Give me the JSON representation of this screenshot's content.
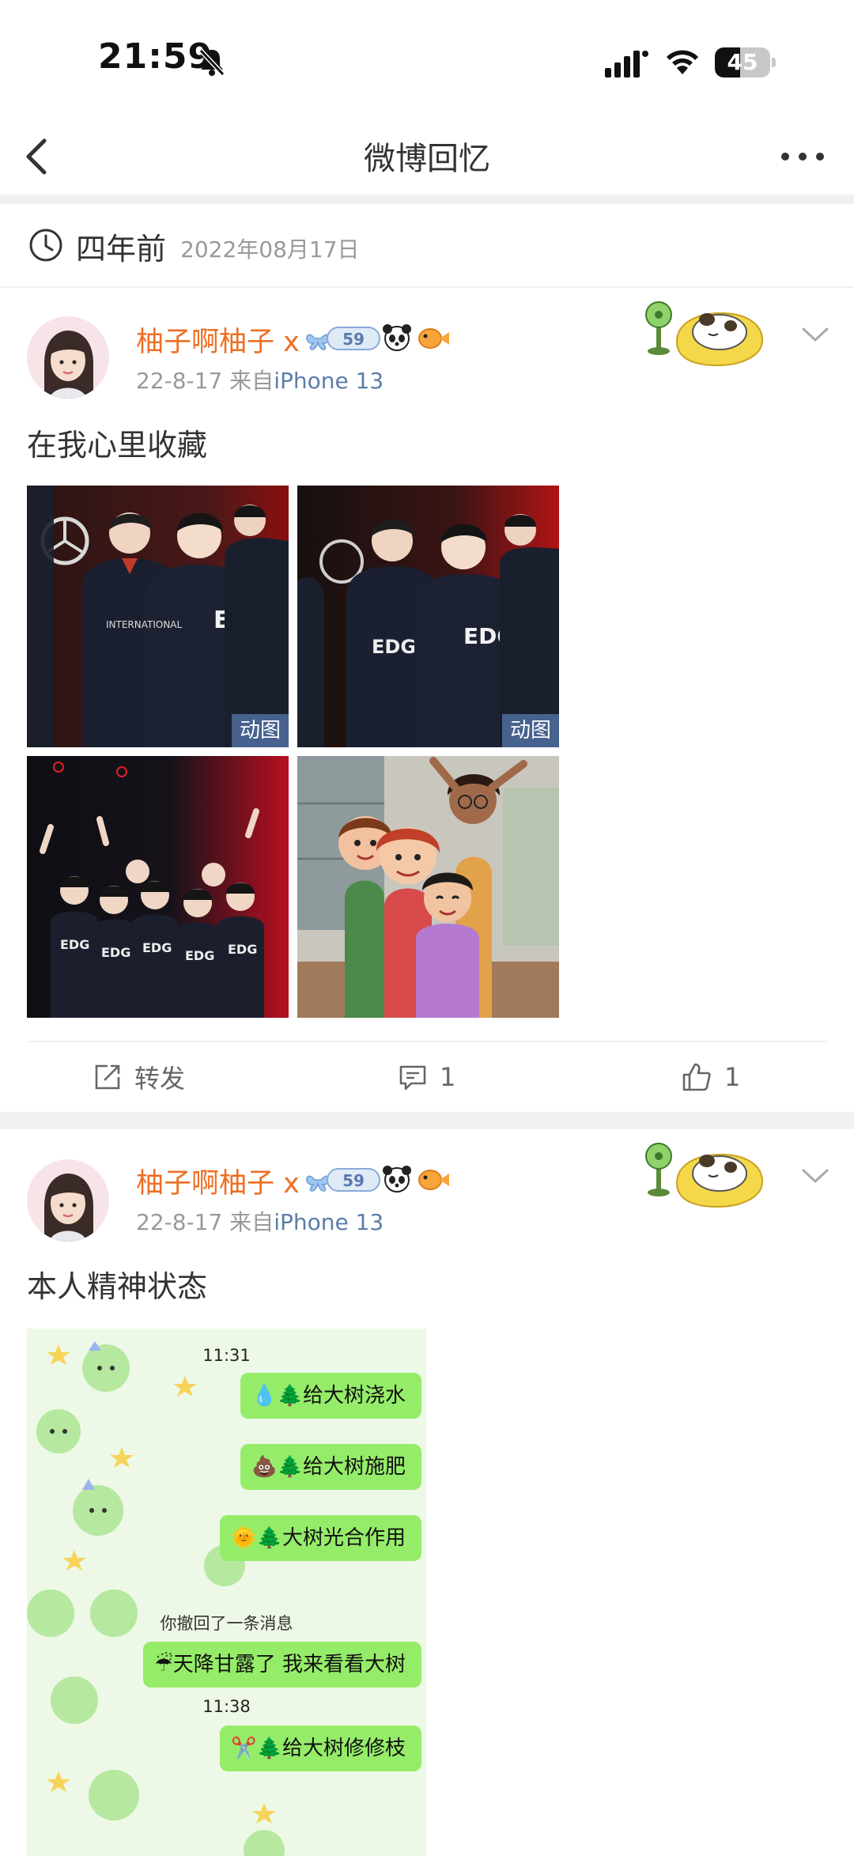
{
  "status_bar": {
    "time": "21:59",
    "battery_level": "45",
    "battery_fraction": 0.45
  },
  "nav": {
    "title": "微博回忆",
    "back_icon": "chevron-left-icon",
    "more_icon": "more-dots-icon"
  },
  "memory_header": {
    "icon": "clock-icon",
    "label": "四年前",
    "date": "2022年08月17日"
  },
  "colors": {
    "username": "#ee6f24",
    "device_link": "#5c7da8",
    "chat_bubble": "#95ec69",
    "separator": "#f1f1f1"
  },
  "posts": [
    {
      "username": "柚子啊柚子",
      "username_suffix": "x",
      "level": "59",
      "meta_prefix": "22-8-17  来自",
      "device": "iPhone 13",
      "text": "在我心里收藏",
      "images": [
        {
          "tag": "动图"
        },
        {
          "tag": "动图"
        },
        {
          "tag": ""
        },
        {
          "tag": ""
        }
      ],
      "actions": {
        "repost_label": "转发",
        "comment_count": "1",
        "like_count": "1"
      }
    },
    {
      "username": "柚子啊柚子",
      "username_suffix": "x",
      "level": "59",
      "meta_prefix": "22-8-17  来自",
      "device": "iPhone 13",
      "text": "本人精神状态",
      "chat": {
        "time1": "11:31",
        "msg1": "💧🌲给大树浇水",
        "msg2": "💩🌲给大树施肥",
        "msg3": "🌞🌲大树光合作用",
        "notice": "你撤回了一条消息",
        "msg4": "☔天降甘露了 我来看看大树",
        "time2": "11:38",
        "msg5": "✂️🌲给大树修修枝"
      }
    }
  ]
}
